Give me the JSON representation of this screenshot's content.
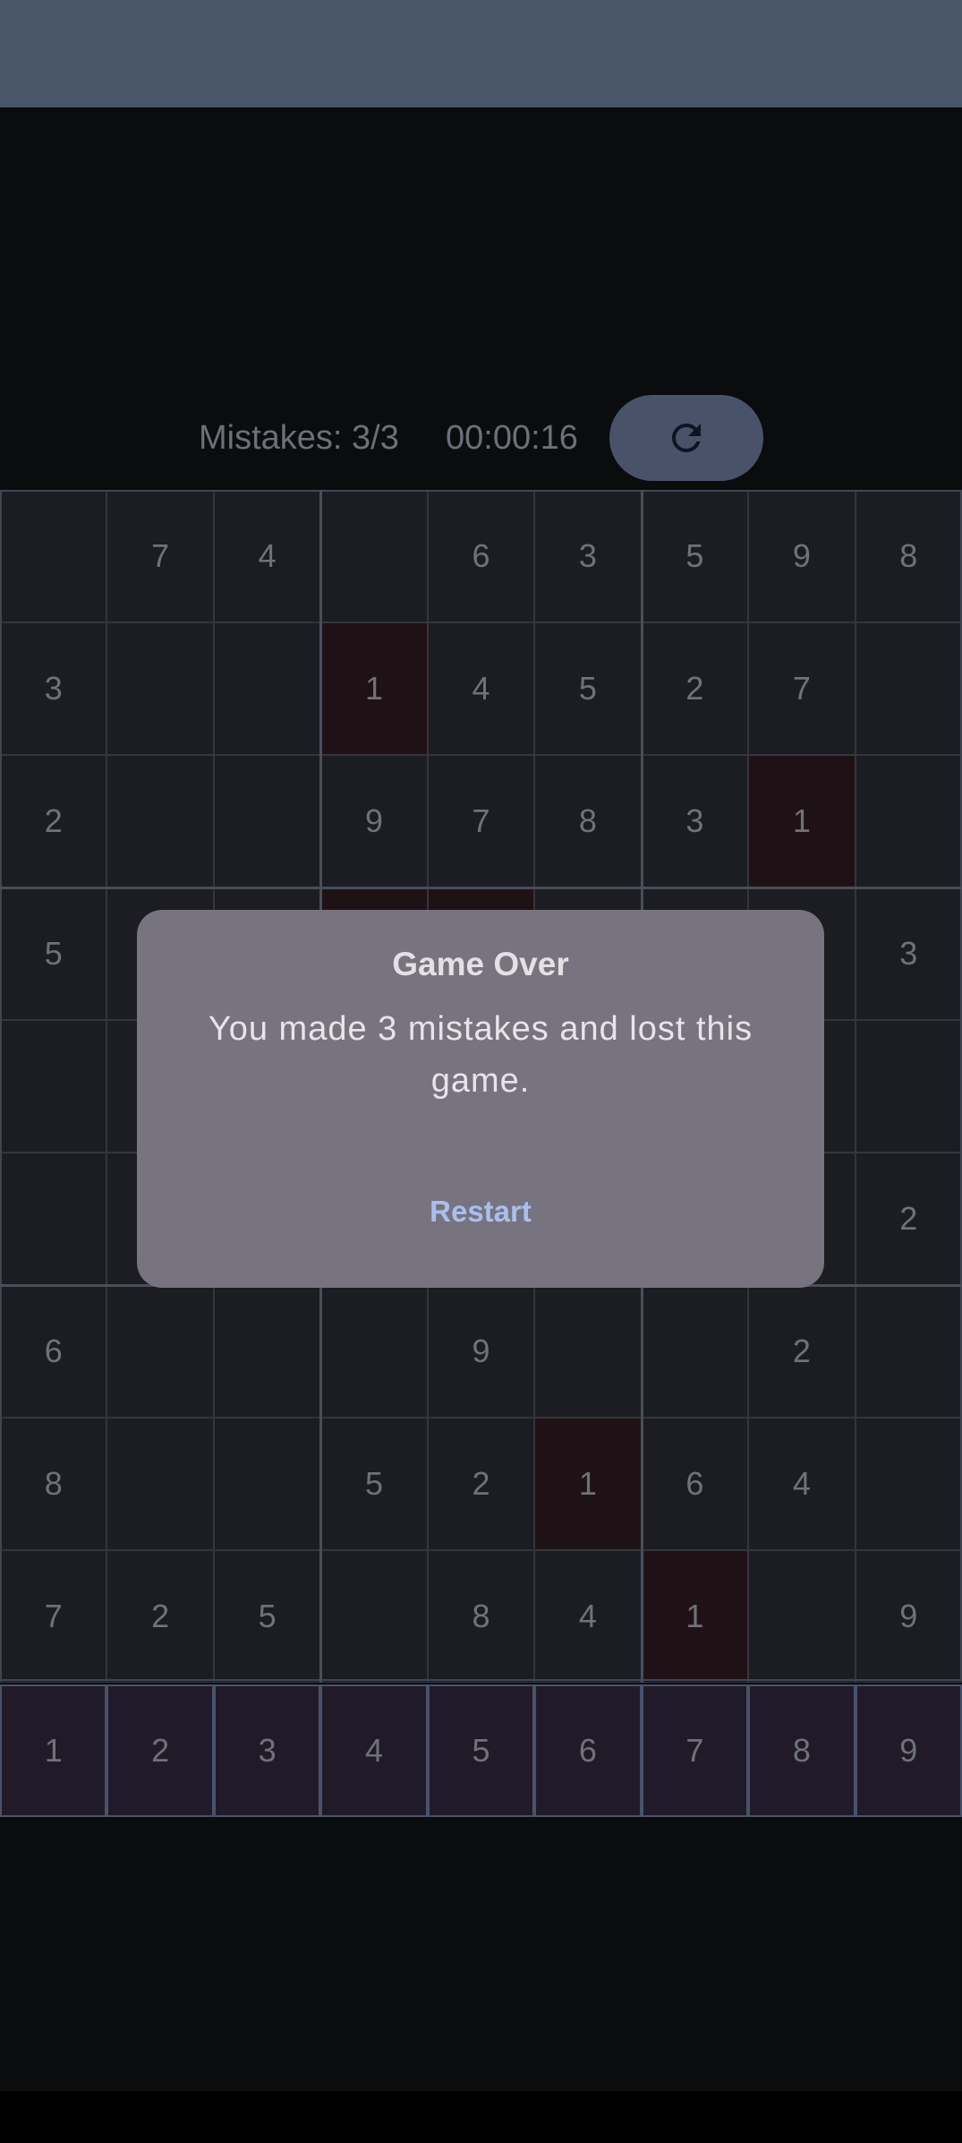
{
  "header": {
    "mistakes_label": "Mistakes: 3/3",
    "timer": "00:00:16",
    "restart_icon": "refresh-icon"
  },
  "board": {
    "rows": [
      [
        "",
        "7",
        "4",
        "",
        "6",
        "3",
        "5",
        "9",
        "8"
      ],
      [
        "3",
        "",
        "",
        "1",
        "4",
        "5",
        "2",
        "7",
        ""
      ],
      [
        "2",
        "",
        "",
        "9",
        "7",
        "8",
        "3",
        "1",
        ""
      ],
      [
        "5",
        "",
        "",
        "",
        "",
        "",
        "",
        "",
        "3"
      ],
      [
        "",
        "",
        "",
        "",
        "",
        "",
        "",
        "",
        ""
      ],
      [
        "",
        "",
        "",
        "",
        "",
        "",
        "",
        "",
        "2"
      ],
      [
        "6",
        "",
        "",
        "",
        "9",
        "",
        "",
        "2",
        ""
      ],
      [
        "8",
        "",
        "",
        "5",
        "2",
        "1",
        "6",
        "4",
        ""
      ],
      [
        "7",
        "2",
        "5",
        "",
        "8",
        "4",
        "1",
        "",
        "9"
      ]
    ],
    "error_cells": [
      [
        1,
        3
      ],
      [
        2,
        7
      ],
      [
        3,
        3
      ],
      [
        3,
        4
      ],
      [
        7,
        5
      ],
      [
        8,
        6
      ]
    ]
  },
  "number_pad": [
    "1",
    "2",
    "3",
    "4",
    "5",
    "6",
    "7",
    "8",
    "9"
  ],
  "dialog": {
    "title": "Game Over",
    "message": "You made 3 mistakes and lost this game.",
    "action_label": "Restart"
  },
  "colors": {
    "status_bar": "#495569",
    "background": "#0b0c0e",
    "dialog": "#77737f",
    "accent": "#a9c0ee",
    "error_cell": "#1f1216"
  }
}
